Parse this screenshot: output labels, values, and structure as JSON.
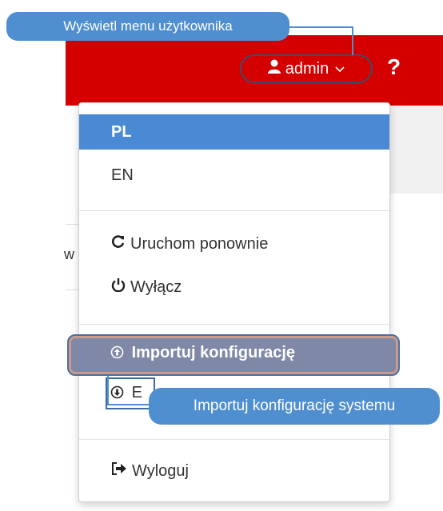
{
  "header": {
    "user_menu_label": "admin",
    "help_label": "?",
    "background_fragment": "w"
  },
  "dropdown": {
    "languages": [
      {
        "label": "PL",
        "active": true
      },
      {
        "label": "EN",
        "active": false
      }
    ],
    "restart_label": "Uruchom ponownie",
    "shutdown_label": "Wyłącz",
    "import_label": "Importuj konfigurację",
    "export_partial_label": "E",
    "logout_label": "Wyloguj"
  },
  "tooltips": {
    "user_menu": "Wyświetl menu użytkownika",
    "import": "Importuj konfigurację systemu"
  },
  "colors": {
    "header_bg": "#d40000",
    "active_item": "#4a89d4",
    "tooltip_bg": "#4f8fcf",
    "highlight_bg": "#7f88a6"
  }
}
